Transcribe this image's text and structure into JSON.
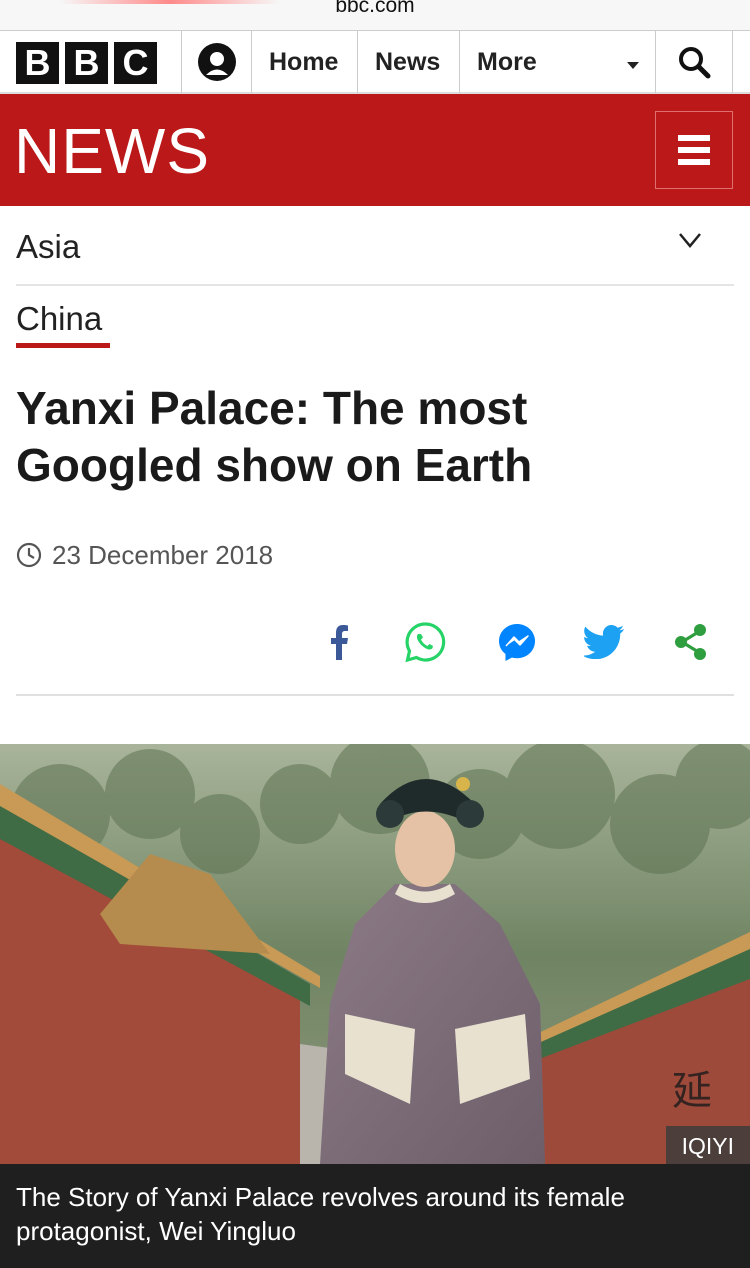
{
  "browser": {
    "url": "bbc.com"
  },
  "top_nav": {
    "logo_letters": [
      "B",
      "B",
      "C"
    ],
    "home_label": "Home",
    "news_label": "News",
    "more_label": "More"
  },
  "banner": {
    "title": "NEWS"
  },
  "section_nav": {
    "label": "Asia"
  },
  "breadcrumb": {
    "label": "China"
  },
  "article": {
    "headline": "Yanxi Palace: The most Googled show on Earth",
    "date": "23 December 2018"
  },
  "share": {
    "icons": [
      "facebook-icon",
      "whatsapp-icon",
      "messenger-icon",
      "twitter-icon",
      "share-icon"
    ],
    "colors": {
      "facebook": "#3b5998",
      "whatsapp": "#25d366",
      "messenger": "#0084ff",
      "twitter": "#1da1f2",
      "share": "#2e9e3f"
    }
  },
  "hero_image": {
    "credit": "IQIYI",
    "caption": "The Story of Yanxi Palace revolves around its female protagonist, Wei Yingluo"
  },
  "colors": {
    "brand_red": "#bb1919"
  }
}
